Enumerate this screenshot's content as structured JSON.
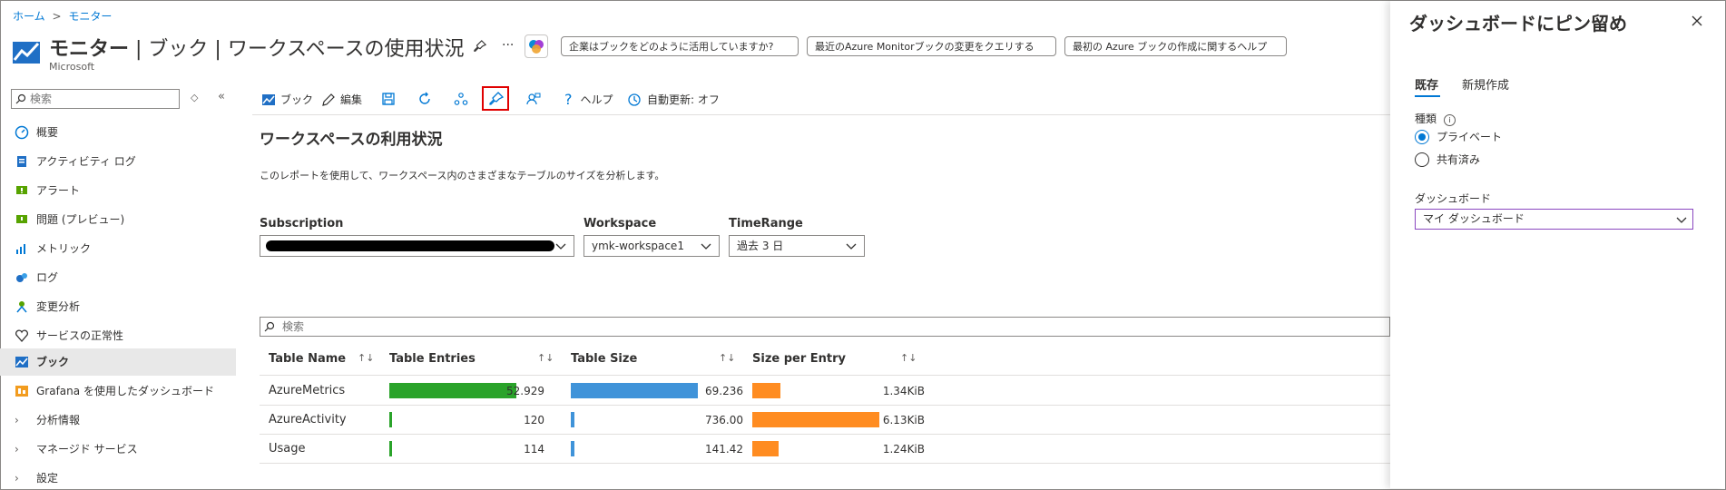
{
  "breadcrumb": {
    "home": "ホーム",
    "monitor": "モニター",
    "sep": ">"
  },
  "header": {
    "title_bold": "モニター",
    "title_rest": "| ブック | ワークスペースの使用状況",
    "publisher": "Microsoft",
    "more": "···",
    "links": [
      "企業はブックをどのように活用していますか?",
      "最近のAzure Monitorブックの変更をクエリする",
      "最初の Azure ブックの作成に関するヘルプ"
    ]
  },
  "sidebar": {
    "search_placeholder": "検索",
    "items": [
      {
        "label": "概要",
        "icon": "overview-icon"
      },
      {
        "label": "アクティビティ ログ",
        "icon": "activity-log-icon"
      },
      {
        "label": "アラート",
        "icon": "alert-icon"
      },
      {
        "label": "問題 (プレビュー)",
        "icon": "issues-icon"
      },
      {
        "label": "メトリック",
        "icon": "metrics-icon"
      },
      {
        "label": "ログ",
        "icon": "logs-icon"
      },
      {
        "label": "変更分析",
        "icon": "change-analysis-icon"
      },
      {
        "label": "サービスの正常性",
        "icon": "service-health-icon"
      },
      {
        "label": "ブック",
        "icon": "workbook-icon"
      },
      {
        "label": "Grafana を使用したダッシュボード",
        "icon": "grafana-icon"
      }
    ],
    "groups": [
      "分析情報",
      "マネージド サービス",
      "設定"
    ]
  },
  "toolbar": {
    "workbook": "ブック",
    "edit": "編集",
    "help": "ヘルプ",
    "auto_refresh": "自動更新: オフ"
  },
  "report": {
    "title": "ワークスペースの利用状況",
    "description": "このレポートを使用して、ワークスペース内のさまざまなテーブルのサイズを分析します。",
    "params": {
      "subscription_label": "Subscription",
      "workspace_label": "Workspace",
      "workspace_value": "ymk-workspace1",
      "timerange_label": "TimeRange",
      "timerange_value": "過去 3 日"
    },
    "grid_search_placeholder": "検索",
    "columns": [
      "Table Name",
      "Table Entries",
      "Table Size",
      "Size per Entry"
    ],
    "sort_icon": "↑↓",
    "rows": [
      {
        "name": "AzureMetrics",
        "entries": "52.929",
        "entries_frac": 1.0,
        "size": "69.236",
        "size_frac": 1.0,
        "per": "1.34KiB",
        "per_frac": 0.22
      },
      {
        "name": "AzureActivity",
        "entries": "120",
        "entries_frac": 0.02,
        "size": "736.00",
        "size_frac": 0.03,
        "per": "6.13KiB",
        "per_frac": 1.0
      },
      {
        "name": "Usage",
        "entries": "114",
        "entries_frac": 0.02,
        "size": "141.42",
        "size_frac": 0.03,
        "per": "1.24KiB",
        "per_frac": 0.21
      }
    ]
  },
  "pin_panel": {
    "title": "ダッシュボードにピン留め",
    "tabs": [
      "既存",
      "新規作成"
    ],
    "type_label": "種類",
    "options": [
      "プライベート",
      "共有済み"
    ],
    "dashboard_label": "ダッシュボード",
    "dashboard_value": "マイ ダッシュボード"
  },
  "colors": {
    "accent": "#0078d4",
    "green": "#2aa32a",
    "blue": "#3f93d9",
    "orange": "#ff8c21",
    "highlight": "#e00000"
  }
}
